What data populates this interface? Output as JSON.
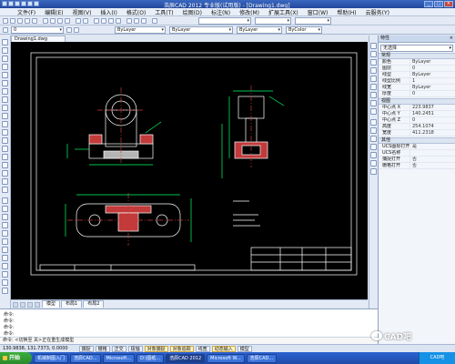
{
  "window": {
    "title": "浩辰CAD 2012 专业版(试用版) - [Drawing1.dwg]"
  },
  "menu": [
    "文件(F)",
    "编辑(E)",
    "视图(V)",
    "插入(I)",
    "格式(O)",
    "工具(T)",
    "绘图(D)",
    "标注(N)",
    "修改(M)",
    "扩展工具(X)",
    "窗口(W)",
    "帮助(H)",
    "云服务(Y)"
  ],
  "toolbar2": {
    "layer_combo": "0",
    "color_combo": "ByLayer",
    "linetype_combo": "ByLayer",
    "lineweight_combo": "ByLayer",
    "plot_combo": "ByColor"
  },
  "doc_tab": "Drawing1.dwg",
  "layout_tabs": [
    "模型",
    "布局1",
    "布局2"
  ],
  "command_lines": [
    "命令:",
    "命令:",
    "命令:",
    "命令:"
  ],
  "command_prompt": "命令: <切换至 关>正在重生成模型",
  "status": {
    "coords": "130.9838, 131.7373, 0.0000",
    "buttons": [
      {
        "label": "捕捉",
        "on": false
      },
      {
        "label": "栅格",
        "on": false
      },
      {
        "label": "正交",
        "on": false
      },
      {
        "label": "极轴",
        "on": false
      },
      {
        "label": "对象捕捉",
        "on": true
      },
      {
        "label": "对象追踪",
        "on": true
      },
      {
        "label": "线宽",
        "on": false
      },
      {
        "label": "动态输入",
        "on": true
      },
      {
        "label": "模型",
        "on": false
      }
    ]
  },
  "properties": {
    "header": "特性",
    "selection": "无选择",
    "groups": [
      {
        "title": "常规",
        "rows": [
          {
            "k": "颜色",
            "v": "ByLayer"
          },
          {
            "k": "图层",
            "v": "0"
          },
          {
            "k": "线型",
            "v": "ByLayer"
          },
          {
            "k": "线型比例",
            "v": "1"
          },
          {
            "k": "线宽",
            "v": "ByLayer"
          },
          {
            "k": "厚度",
            "v": "0"
          }
        ]
      },
      {
        "title": "视图",
        "rows": [
          {
            "k": "中心点 X",
            "v": "223.9837"
          },
          {
            "k": "中心点 Y",
            "v": "140.2451"
          },
          {
            "k": "中心点 Z",
            "v": "0"
          },
          {
            "k": "高度",
            "v": "254.1074"
          },
          {
            "k": "宽度",
            "v": "411.2318"
          }
        ]
      },
      {
        "title": "其他",
        "rows": [
          {
            "k": "UCS图标打开",
            "v": "是"
          },
          {
            "k": "UCS名称",
            "v": ""
          },
          {
            "k": "捕捉打开",
            "v": "否"
          },
          {
            "k": "栅格打开",
            "v": "否"
          }
        ]
      }
    ]
  },
  "taskbar": {
    "start": "开始",
    "tasks": [
      "机械制图入门",
      "浩辰CAD...",
      "Microsoft...",
      "D:\\图纸...",
      "浩辰CAD 2012",
      "Microsoft W...",
      "浩辰CAD..."
    ],
    "tray": "CAD吧"
  },
  "watermark": "CAD吧"
}
